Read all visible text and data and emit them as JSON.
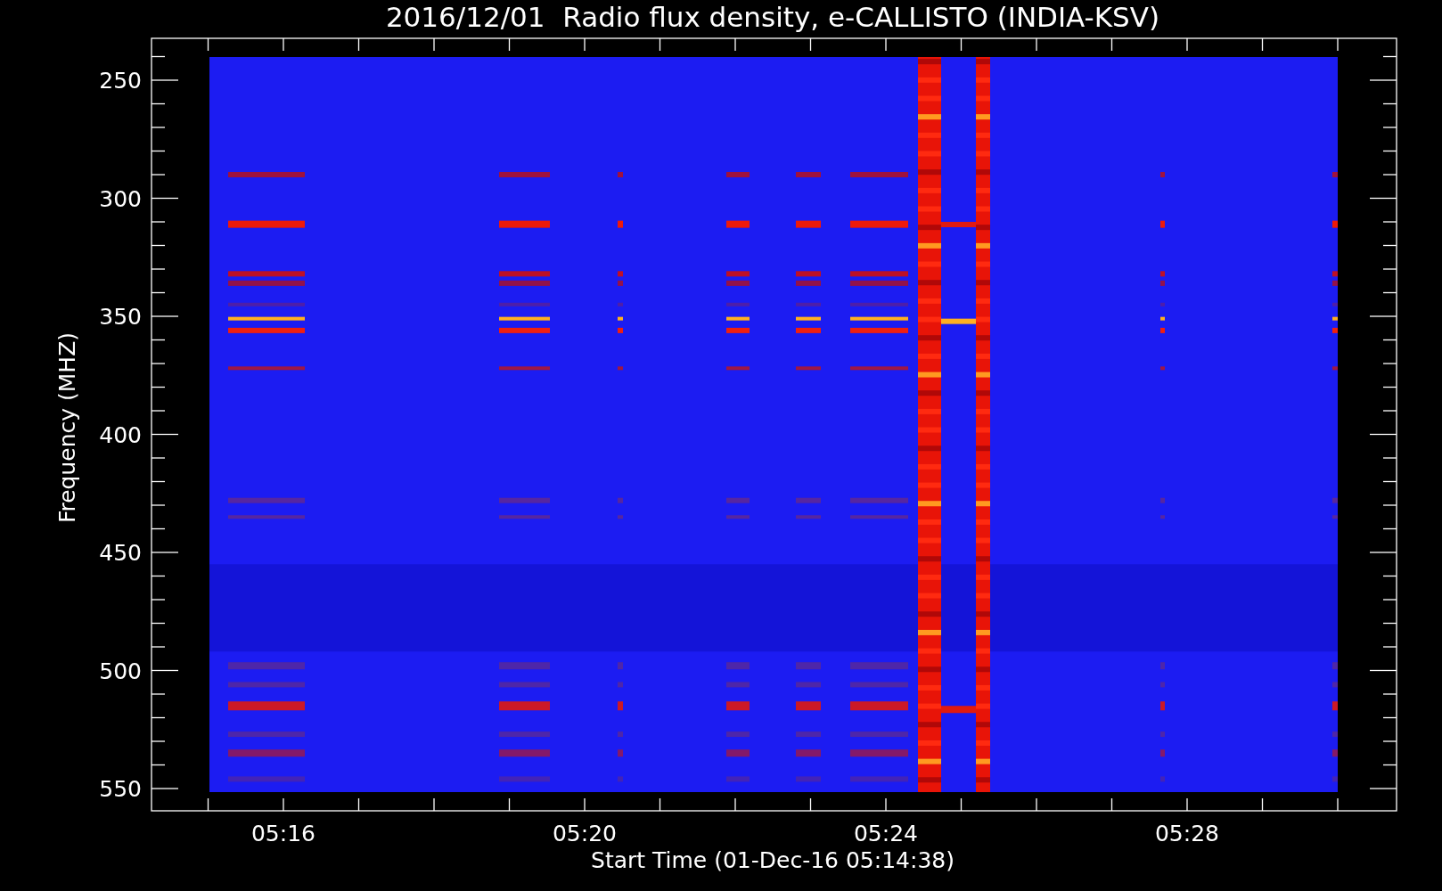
{
  "title": "2016/12/01  Radio flux density, e-CALLISTO (INDIA-KSV)",
  "y_axis": {
    "label": "Frequency (MHZ)",
    "tick_labels": [
      "250",
      "300",
      "350",
      "400",
      "450",
      "500",
      "550"
    ]
  },
  "x_axis": {
    "label": "Start Time (01-Dec-16 05:14:38)",
    "tick_labels": [
      "05:16",
      "05:20",
      "05:24",
      "05:28"
    ]
  }
}
